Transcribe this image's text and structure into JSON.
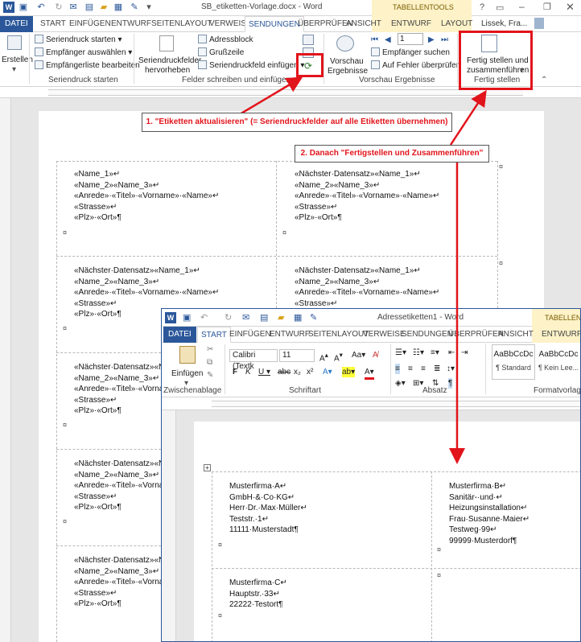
{
  "window1": {
    "title": "SB_etiketten-Vorlage.docx - Word",
    "context_tab_group": "TABELLENTOOLS",
    "user": "Lissek, Fra...",
    "tabs": [
      "DATEI",
      "START",
      "EINFÜGEN",
      "ENTWURF",
      "SEITENLAYOUT",
      "VERWEISE",
      "SENDUNGEN",
      "ÜBERPRÜFEN",
      "ANSICHT",
      "ENTWURF",
      "LAYOUT"
    ],
    "ribbon": {
      "erstellen": "Erstellen",
      "seriendruck_starten": "Seriendruck starten",
      "empfaenger_auswaehlen": "Empfänger auswählen",
      "empfaengerliste": "Empfängerliste bearbeiten",
      "group_seriendruck": "Seriendruck starten",
      "felder_hervorheben_1": "Seriendruckfelder",
      "felder_hervorheben_2": "hervorheben",
      "adressblock": "Adressblock",
      "grusszeile": "Grußzeile",
      "feld_einfuegen": "Seriendruckfeld einfügen",
      "group_felder": "Felder schreiben und einfügen",
      "vorschau_1": "Vorschau",
      "vorschau_2": "Ergebnisse",
      "record_number": "1",
      "empfaenger_suchen": "Empfänger suchen",
      "fehler_pruefen": "Auf Fehler überprüfen",
      "group_vorschau": "Vorschau Ergebnisse",
      "fertig_1": "Fertig stellen und",
      "fertig_2": "zusammenführen",
      "group_fertig": "Fertig stellen"
    },
    "cells": [
      "«Name_1»↵\n«Name_2»«Name_3»↵\n«Anrede»·«Titel»·«Vorname»·«Name»↵\n«Strasse»↵\n«Plz»·«Ort»¶",
      "«Nächster·Datensatz»«Name_1»↵\n«Name_2»«Name_3»↵\n«Anrede»·«Titel»·«Vorname»·«Name»↵\n«Strasse»↵\n«Plz»·«Ort»¶",
      "«Nächster·Datensatz»«Name_1»↵\n«Name_2»«Name_3»↵\n«Anrede»·«Titel»·«Vorname»·«Name»↵\n«Strasse»↵\n«Plz»·«Ort»¶",
      "«Nächster·Datensatz»«Name_1»↵\n«Name_2»«Name_3»↵\n«Anrede»·«Titel»·«Vorname»·«Name»↵\n«Strasse»↵",
      "«Nächster·Datensatz»«N\n«Name_2»«Name_3»↵\n«Anrede»·«Titel»·«Vorna\n«Strasse»↵\n«Plz»·«Ort»¶",
      "«Nächster·Datensatz»«N\n«Name_2»«Name_3»↵\n«Anrede»·«Titel»·«Vorna\n«Strasse»↵\n«Plz»·«Ort»¶",
      "«Nächster·Datensatz»«N\n«Name_2»«Name_3»↵\n«Anrede»·«Titel»·«Vorna\n«Strasse»↵\n«Plz»·«Ort»¶"
    ]
  },
  "window2": {
    "title": "Adressetiketten1 - Word",
    "context_tab_group": "TABELLENTO",
    "tabs": [
      "DATEI",
      "START",
      "EINFÜGEN",
      "ENTWURF",
      "SEITENLAYOUT",
      "VERWEISE",
      "SENDUNGEN",
      "ÜBERPRÜFEN",
      "ANSICHT",
      "ENTWURF"
    ],
    "paste": "Einfügen",
    "font_name": "Calibri (Textk",
    "font_size": "11",
    "style1_sample": "AaBbCcDc",
    "style1_name": "¶ Standard",
    "style2_sample": "AaBbCcDc",
    "style2_name": "¶ Kein Lee...",
    "groups": [
      "Zwischenablage",
      "Schriftart",
      "Absatz",
      "Formatvorlagen"
    ],
    "labels": [
      "Musterfirma·A↵\nGmbH·&·Co·KG↵\nHerr·Dr.·Max·Müller↵\nTeststr.·1↵\n11111·Musterstadt¶",
      "Musterfirma·B↵\nSanitär-·und·↵\nHeizungsinstallation↵\nFrau·Susanne·Maier↵\nTestweg·99↵\n99999·Musterdorf¶",
      "Musterfirma·C↵\nHauptstr.·33↵\n22222·Testort¶"
    ]
  },
  "annotations": {
    "step1": "1. \"Etiketten aktualisieren\" (= Seriendruckfelder auf alle Etiketten übernehmen)",
    "step2": "2. Danach \"Fertigstellen und Zusammenführen\""
  },
  "colors": {
    "accent": "#2b579a",
    "annotation": "#e2141b",
    "context_tab": "#fdf2c8"
  }
}
